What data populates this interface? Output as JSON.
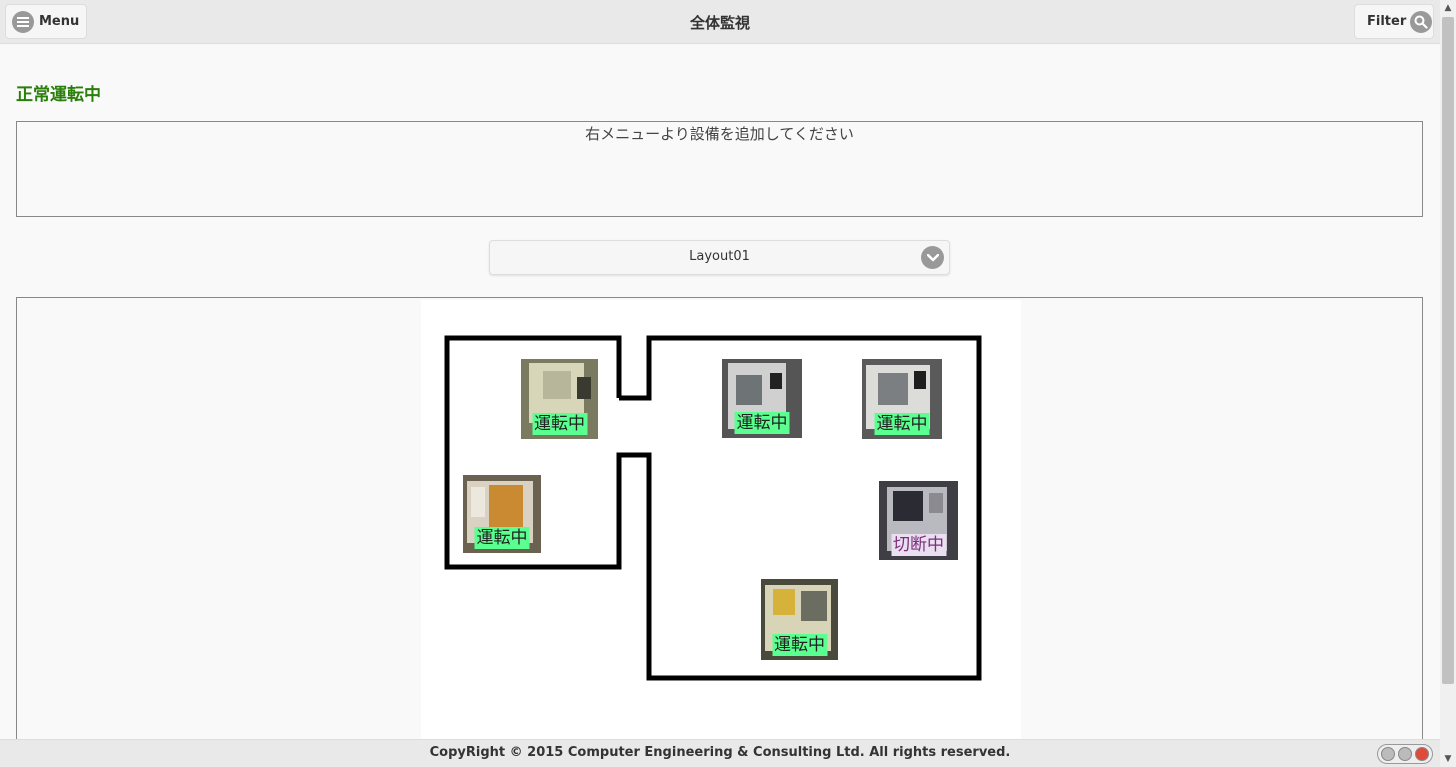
{
  "header": {
    "menu_label": "Menu",
    "title": "全体監視",
    "filter_label": "Filter"
  },
  "status": {
    "heading": "正常運転中",
    "color": "#2a7f0a"
  },
  "notice": {
    "text": "右メニューより設備を追加してください"
  },
  "layout_select": {
    "value": "Layout01"
  },
  "machines": [
    {
      "id": "m1",
      "state": "running",
      "label": "運転中"
    },
    {
      "id": "m2",
      "state": "running",
      "label": "運転中"
    },
    {
      "id": "m3",
      "state": "running",
      "label": "運転中"
    },
    {
      "id": "m4",
      "state": "running",
      "label": "運転中"
    },
    {
      "id": "m5",
      "state": "cut",
      "label": "切断中"
    },
    {
      "id": "m6",
      "state": "running",
      "label": "運転中"
    }
  ],
  "footer": {
    "copyright": "CopyRight © 2015 Computer Engineering & Consulting Ltd. All rights reserved.",
    "lamps": [
      {
        "name": "lamp-1",
        "color": "#bbbbbb"
      },
      {
        "name": "lamp-2",
        "color": "#bbbbbb"
      },
      {
        "name": "lamp-3",
        "color": "#e04a3a"
      }
    ]
  },
  "colors": {
    "running_badge": "#5bff8f",
    "cut_badge": "#eadff0"
  }
}
